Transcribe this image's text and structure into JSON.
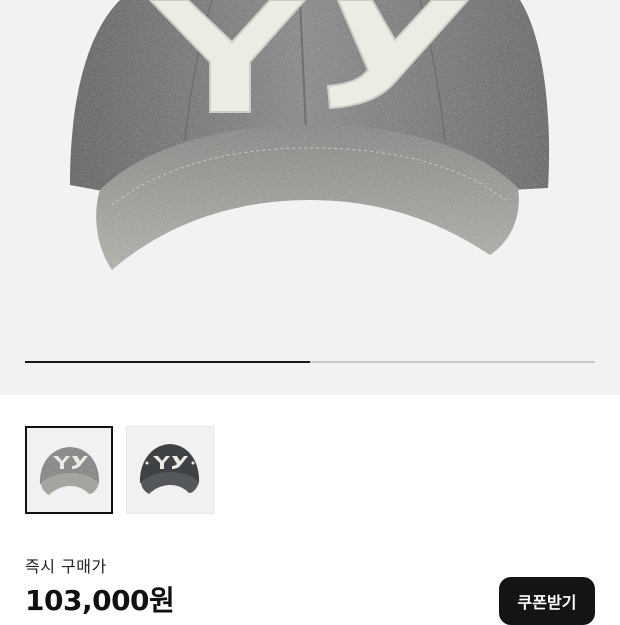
{
  "product": {
    "image_progress": 0.5,
    "thumbnails": [
      {
        "variant": "washed-grey",
        "selected": true
      },
      {
        "variant": "charcoal",
        "selected": false
      }
    ],
    "price_label": "즉시 구매가",
    "price": "103,000원",
    "coupon_button": "쿠폰받기"
  },
  "colors": {
    "accent": "#141414",
    "hero_bg": "#f2f2f2",
    "cap_grey": "#8a8a8a",
    "cap_charcoal": "#3f4245",
    "logo_cream": "#ecebe4"
  }
}
